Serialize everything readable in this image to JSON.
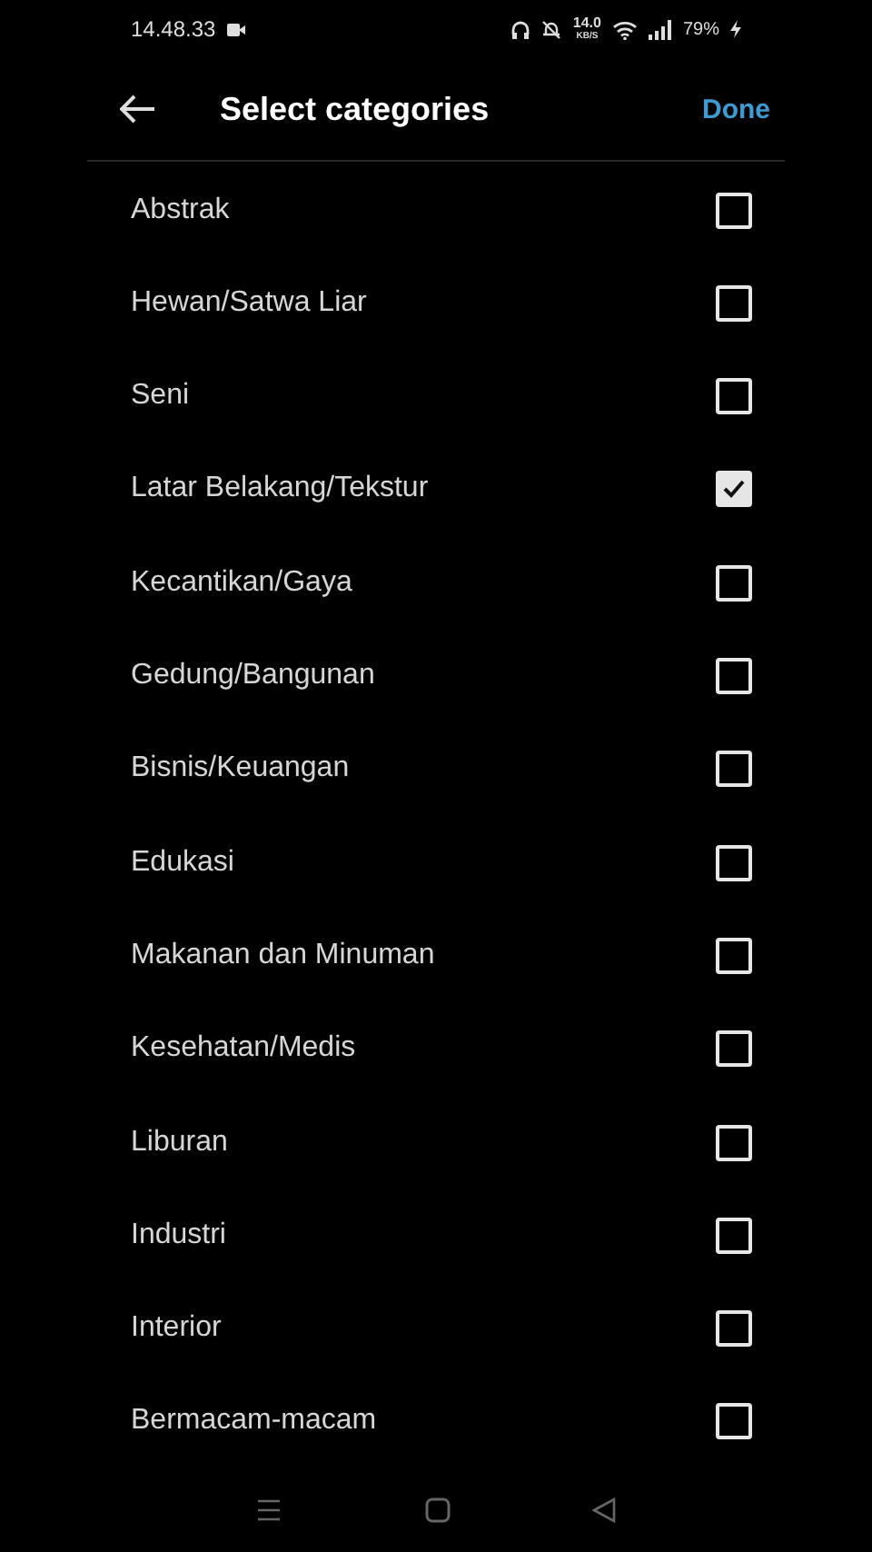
{
  "status_bar": {
    "time": "14.48.33",
    "speed": "14.0",
    "speed_unit": "KB/S",
    "battery": "79%"
  },
  "header": {
    "title": "Select categories",
    "action": "Done"
  },
  "categories": [
    {
      "label": "Abstrak",
      "checked": false
    },
    {
      "label": "Hewan/Satwa Liar",
      "checked": false
    },
    {
      "label": "Seni",
      "checked": false
    },
    {
      "label": "Latar Belakang/Tekstur",
      "checked": true
    },
    {
      "label": "Kecantikan/Gaya",
      "checked": false
    },
    {
      "label": "Gedung/Bangunan",
      "checked": false
    },
    {
      "label": "Bisnis/Keuangan",
      "checked": false
    },
    {
      "label": "Edukasi",
      "checked": false
    },
    {
      "label": "Makanan dan Minuman",
      "checked": false
    },
    {
      "label": "Kesehatan/Medis",
      "checked": false
    },
    {
      "label": "Liburan",
      "checked": false
    },
    {
      "label": "Industri",
      "checked": false
    },
    {
      "label": "Interior",
      "checked": false
    },
    {
      "label": "Bermacam-macam",
      "checked": false
    }
  ]
}
